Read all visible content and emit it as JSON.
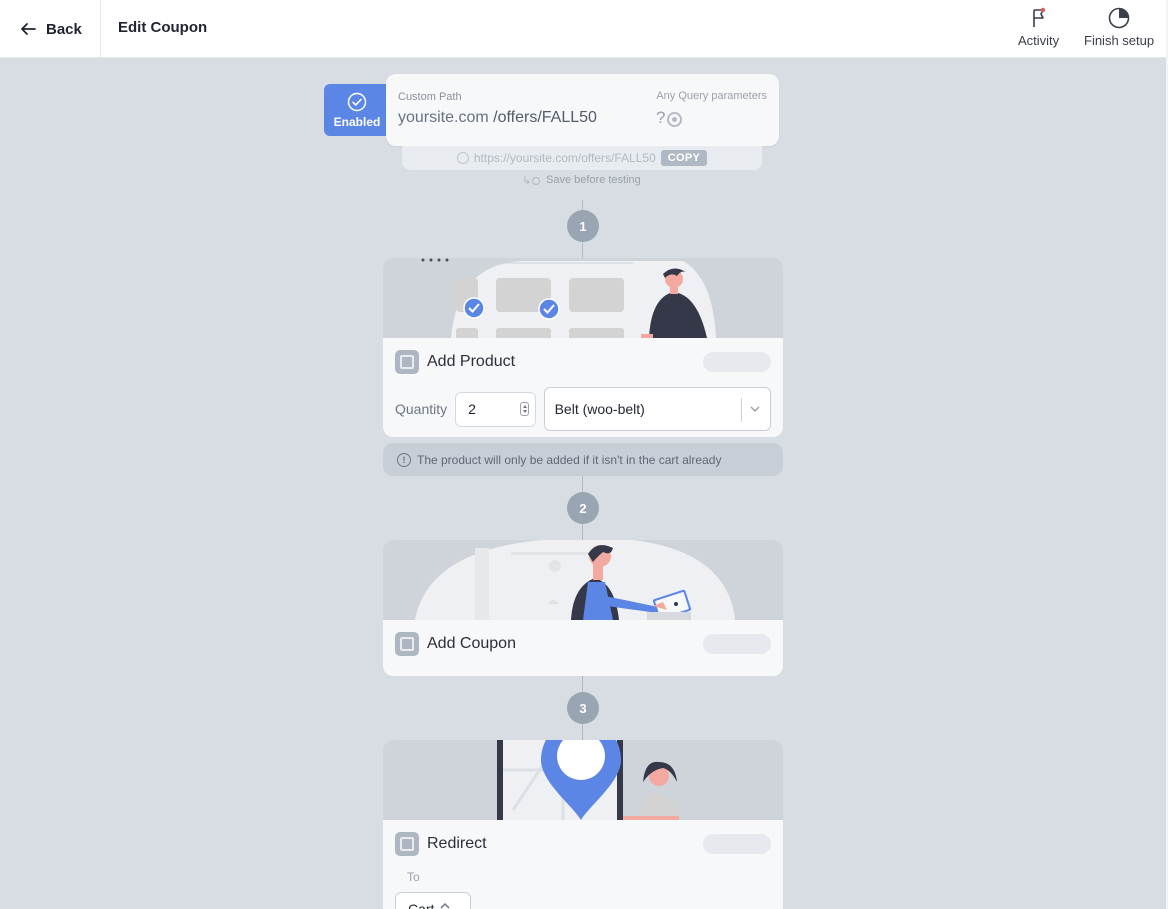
{
  "header": {
    "back_label": "Back",
    "title": "Edit Coupon",
    "actions": [
      {
        "label": "Activity",
        "icon": "flag-icon"
      },
      {
        "label": "Finish setup",
        "icon": "progress-icon"
      }
    ]
  },
  "coupon": {
    "status_label": "Enabled",
    "custom_path_label": "Custom Path",
    "domain": "yoursite.com",
    "slug": "/offers/FALL50",
    "query_label": "Any Query parameters",
    "query_value": "?",
    "full_url": "https://yoursite.com/offers/FALL50",
    "copy_label": "COPY",
    "save_hint": "Save before testing"
  },
  "steps": [
    {
      "number": "1",
      "title": "Add Product",
      "quantity_label": "Quantity",
      "quantity_value": "2",
      "product_selected": "Belt (woo-belt)",
      "info": "The product will only be added if it isn't in the cart already"
    },
    {
      "number": "2",
      "title": "Add Coupon"
    },
    {
      "number": "3",
      "title": "Redirect",
      "to_label": "To",
      "to_value": "Cart"
    }
  ],
  "colors": {
    "accent": "#5b86e5",
    "background": "#d8dde3",
    "card": "#f7f8fa",
    "step_badge": "#9aa5b3"
  }
}
